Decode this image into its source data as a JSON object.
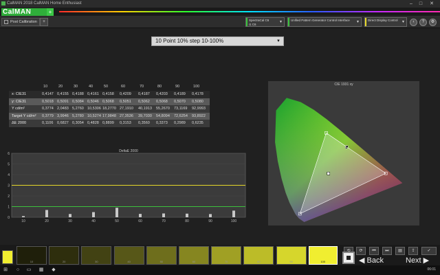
{
  "window": {
    "title": "CalMAN 2018 CalMAN Home Enthusiast"
  },
  "logo": {
    "text": "CalMAN",
    "plus": "+"
  },
  "toolbar": {
    "tab_label": "Post Calibration",
    "small_button": "+",
    "devices": [
      {
        "label1": "SpectraCal C6",
        "label2": "i1 C6",
        "color": "#39c23c"
      },
      {
        "label1": "Unified Pattern Generator Control Interface",
        "label2": "",
        "color": "#39c23c"
      },
      {
        "label1": "Direct Display Control",
        "label2": "",
        "color": "#e6d82a"
      }
    ],
    "icons": [
      "back-icon",
      "help-icon",
      "settings-icon"
    ]
  },
  "preset": {
    "value": "10 Point 10% step 10-100%"
  },
  "table": {
    "headers": [
      "10",
      "20",
      "30",
      "40",
      "50",
      "60",
      "70",
      "80",
      "90",
      "100"
    ],
    "rows": [
      {
        "label": "x: CIE31",
        "values": [
          "0,4147",
          "0,4155",
          "0,4188",
          "0,4161",
          "0,4158",
          "0,4209",
          "0,4187",
          "0,4203",
          "0,4189",
          "0,4178"
        ],
        "bg": "#2a2a2a"
      },
      {
        "label": "y: CIE31",
        "values": [
          "0,5018",
          "0,5091",
          "0,5084",
          "0,5046",
          "0,5068",
          "0,5051",
          "0,5062",
          "0,5068",
          "0,5070",
          "0,5080"
        ],
        "bg": "#5a5a5a"
      },
      {
        "label": "Y cd/m²",
        "values": [
          "0,3774",
          "2,0483",
          "5,2760",
          "10,5306",
          "18,2770",
          "27,1910",
          "40,1913",
          "55,2670",
          "73,1169",
          "92,9993"
        ],
        "bg": "#3a3a3a"
      },
      {
        "label": "Target Y cd/m²",
        "values": [
          "0,3779",
          "3,9946",
          "5,2780",
          "10,5274",
          "17,9848",
          "27,3536",
          "39,7030",
          "54,8094",
          "72,6254",
          "93,8922"
        ],
        "bg": "#5a5a5a"
      },
      {
        "label": "ΔE 2000",
        "values": [
          "0,1106",
          "0,6827",
          "0,3054",
          "0,4828",
          "0,8899",
          "0,3153",
          "0,3560",
          "0,3373",
          "0,2989",
          "0,6235"
        ],
        "bg": "#3a3a3a"
      }
    ]
  },
  "chart_data": [
    {
      "type": "bar",
      "title": "DeltaE 2000",
      "categories": [
        "10",
        "20",
        "30",
        "40",
        "50",
        "60",
        "70",
        "80",
        "90",
        "100"
      ],
      "values": [
        0.1106,
        0.6827,
        0.3054,
        0.4828,
        0.8899,
        0.3153,
        0.356,
        0.3373,
        0.2989,
        0.6235
      ],
      "ylim": [
        0,
        6
      ],
      "yticks": [
        "0",
        "1",
        "2",
        "3",
        "4",
        "5",
        "6"
      ],
      "xticks": [
        "10",
        "20",
        "30",
        "40",
        "50",
        "60",
        "70",
        "80",
        "90",
        "100"
      ],
      "threshold_lines": [
        {
          "y": 3,
          "color": "#e6d82a"
        },
        {
          "y": 1,
          "color": "#3cc23c"
        }
      ]
    },
    {
      "type": "scatter",
      "title": "CIE 1931 xy",
      "gamut_target": [
        [
          0.64,
          0.33
        ],
        [
          0.3,
          0.6
        ],
        [
          0.15,
          0.06
        ]
      ],
      "white_point": [
        0.3127,
        0.329
      ],
      "measured_points": [
        {
          "x": 0.4147,
          "y": 0.5018
        },
        {
          "x": 0.4155,
          "y": 0.5091
        },
        {
          "x": 0.4188,
          "y": 0.5084
        }
      ]
    }
  ],
  "swatches": {
    "items": [
      {
        "label": "10",
        "color": "#1f1f0a"
      },
      {
        "label": "20",
        "color": "#2e2e0d"
      },
      {
        "label": "30",
        "color": "#424213"
      },
      {
        "label": "40",
        "color": "#575718"
      },
      {
        "label": "50",
        "color": "#6e6e1c"
      },
      {
        "label": "60",
        "color": "#868620"
      },
      {
        "label": "70",
        "color": "#a0a024"
      },
      {
        "label": "80",
        "color": "#bcbc28"
      },
      {
        "label": "90",
        "color": "#d6d62c"
      },
      {
        "label": "100",
        "color": "#f0ee30"
      }
    ],
    "current_color": "#f0ee30"
  },
  "nav": {
    "back": "Back",
    "next": "Next"
  },
  "taskbar": {
    "time": "06:01"
  }
}
